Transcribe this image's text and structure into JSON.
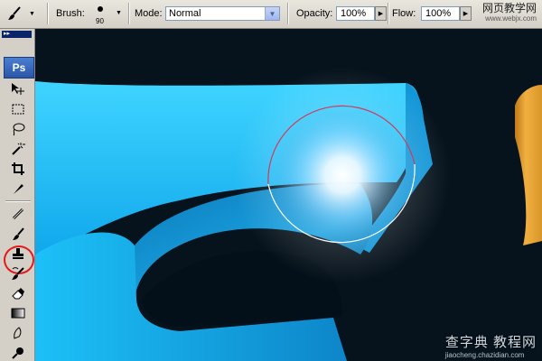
{
  "options_bar": {
    "brush_label": "Brush:",
    "brush_size": "90",
    "mode_label": "Mode:",
    "mode_value": "Normal",
    "opacity_label": "Opacity:",
    "opacity_value": "100%",
    "flow_label": "Flow:",
    "flow_value": "100%"
  },
  "toolbox": {
    "app_badge": "Ps",
    "tools": [
      "move-tool",
      "marquee-tool",
      "lasso-tool",
      "magic-wand-tool",
      "crop-tool",
      "slice-tool",
      "healing-brush-tool",
      "brush-tool",
      "clone-stamp-tool",
      "history-brush-tool",
      "eraser-tool",
      "gradient-tool",
      "smudge-tool",
      "dodge-tool"
    ],
    "selected_tool": "brush-tool",
    "highlight_color": "#e41a1a"
  },
  "watermarks": {
    "top_cn": "网页教学网",
    "top_url": "www.webjx.com",
    "bottom_cn": "查字典 教程网",
    "bottom_url": "jiaocheng.chazidian.com"
  },
  "canvas": {
    "background": "#06121c",
    "shape_color": "#16b6f2",
    "accent_shape_color": "#d9962a",
    "brush_cursor_colors": [
      "#d13a5e",
      "#ffffff"
    ]
  }
}
